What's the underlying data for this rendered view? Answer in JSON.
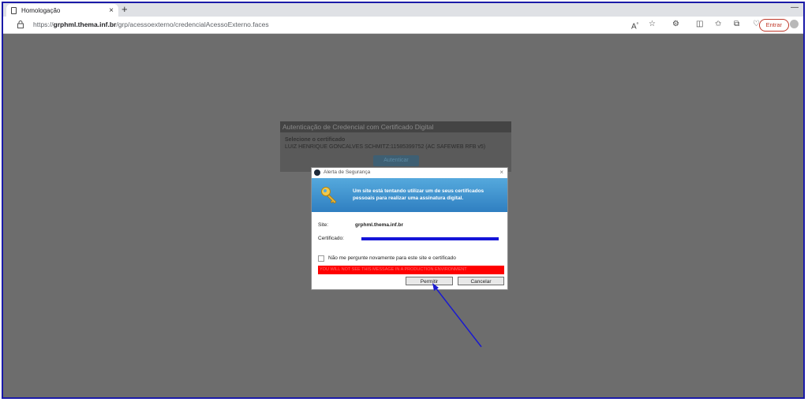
{
  "browser": {
    "tab_title": "Homologação",
    "tab_close": "×",
    "new_tab": "+",
    "minimize": "—",
    "url_prefix": "https://",
    "url_host": "grphml.thema.inf.br",
    "url_path": "/grp/acessoexterno/credencialAcessoExterno.faces",
    "signin_label": "Entrar"
  },
  "auth_panel": {
    "title": "Autenticação de Credencial com Certificado Digital",
    "select_label": "Selecione o certificado",
    "selected_certificate": "LUIZ HENRIQUE GONCALVES SCHMITZ:11585399752 (AC SAFEWEB RFB v5)",
    "authenticate_button": "Autenticar"
  },
  "dialog": {
    "title": "Alerta de Segurança",
    "close": "×",
    "message": "Um site está tentando utilizar um de seus certificados pessoais para realizar uma assinatura digital.",
    "site_label": "Site:",
    "site_value": "grphml.thema.inf.br",
    "certificate_label": "Certificado:",
    "dont_ask_label": "Não me pergunte novamente para este site e certificado",
    "warning": "YOU WILL NOT SEE THIS MESSAGE IN A PRODUCTION ENVIRONMENT",
    "allow_button": "Permitir",
    "cancel_button": "Cancelar"
  },
  "colors": {
    "frame_border": "#1a1aa8",
    "overlay": "#6d6d6d",
    "banner": "#2f7fc1",
    "warning_bg": "#ff0000",
    "redacted_bar": "#1414d8",
    "arrow": "#1a1ad0"
  }
}
